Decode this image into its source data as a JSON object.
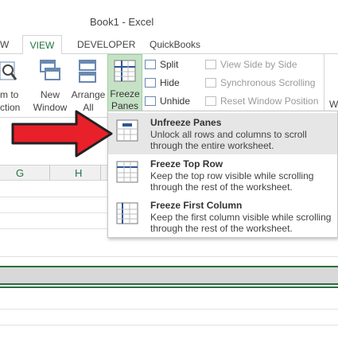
{
  "window": {
    "title": "Book1 - Excel"
  },
  "tabs": [
    {
      "label": "W"
    },
    {
      "label": "VIEW"
    },
    {
      "label": "DEVELOPER"
    },
    {
      "label": "QuickBooks"
    }
  ],
  "ribbon": {
    "zoom_partial_top": "m to",
    "zoom_partial_bottom": "ction",
    "new_window_top": "New",
    "new_window_bottom": "Window",
    "arrange_top": "Arrange",
    "arrange_bottom": "All",
    "freeze_top": "Freeze",
    "freeze_bottom": "Panes ▾",
    "split": "Split",
    "hide": "Hide",
    "unhide": "Unhide",
    "view_side_by_side": "View Side by Side",
    "sync_scrolling": "Synchronous Scrolling",
    "reset_window_position": "Reset Window Position",
    "edge_partial": "W"
  },
  "columns": [
    "G",
    "H"
  ],
  "dropdown": {
    "items": [
      {
        "title": "Unfreeze Panes",
        "desc": "Unlock all rows and columns to scroll through the entire worksheet."
      },
      {
        "title": "Freeze Top Row",
        "desc": "Keep the top row visible while scrolling through the rest of the worksheet."
      },
      {
        "title": "Freeze First Column",
        "desc": "Keep the first column visible while scrolling through the rest of the worksheet."
      }
    ]
  },
  "colors": {
    "accent_green": "#217346",
    "arrow_red": "#e8202a",
    "freeze_active": "#c6e2c6"
  },
  "icons": [
    "zoom-selection-icon",
    "new-window-icon",
    "arrange-all-icon",
    "freeze-panes-icon",
    "split-icon",
    "hide-icon",
    "unhide-icon",
    "view-side-by-side-icon",
    "sync-scrolling-icon",
    "reset-window-icon",
    "unfreeze-panes-icon",
    "freeze-top-row-icon",
    "freeze-first-column-icon",
    "red-arrow"
  ]
}
